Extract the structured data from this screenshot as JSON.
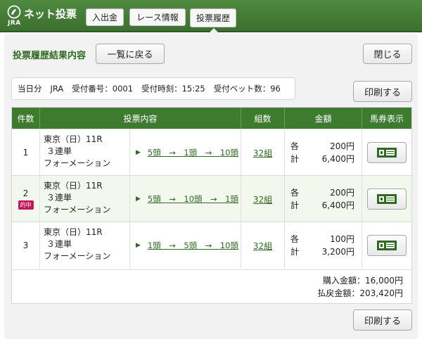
{
  "header": {
    "logo_text": "ネット投票",
    "logo_sub": "JRA",
    "nav": [
      "入出金",
      "レース情報",
      "投票履歴"
    ]
  },
  "page": {
    "title": "投票履歴結果内容",
    "back_label": "一覧に戻る",
    "close_label": "閉じる",
    "print_label": "印刷する"
  },
  "summary": {
    "day": "当日分",
    "org": "JRA",
    "receipt_no": "受付番号：0001",
    "receipt_time": "受付時刻：15:25",
    "bet_count": "受付ベット数：96"
  },
  "table": {
    "headers": [
      "件数",
      "投票内容",
      "組数",
      "金額",
      "馬券表示"
    ],
    "rows": [
      {
        "no": "1",
        "badge": "",
        "race": "東京（日）11R",
        "bet_type": "３連単",
        "method": "フォーメーション",
        "combo": "5頭　→　1頭　→　10頭",
        "kumi": "32組",
        "each_label": "各",
        "each": "200円",
        "total_label": "計",
        "total": "6,400円"
      },
      {
        "no": "2",
        "badge": "的中",
        "race": "東京（日）11R",
        "bet_type": "３連単",
        "method": "フォーメーション",
        "combo": "5頭　→　10頭　→　1頭",
        "kumi": "32組",
        "each_label": "各",
        "each": "200円",
        "total_label": "計",
        "total": "6,400円"
      },
      {
        "no": "3",
        "badge": "",
        "race": "東京（日）11R",
        "bet_type": "３連単",
        "method": "フォーメーション",
        "combo": "1頭　→　5頭　→　10頭",
        "kumi": "32組",
        "each_label": "各",
        "each": "100円",
        "total_label": "計",
        "total": "3,200円"
      }
    ],
    "purchase_total": "購入金額：16,000円",
    "payout_total": "払戻金額：203,420円"
  },
  "colors": {
    "header_green": "#3f7a31",
    "link_green": "#2e6a22",
    "hit_badge": "#c2185b"
  }
}
